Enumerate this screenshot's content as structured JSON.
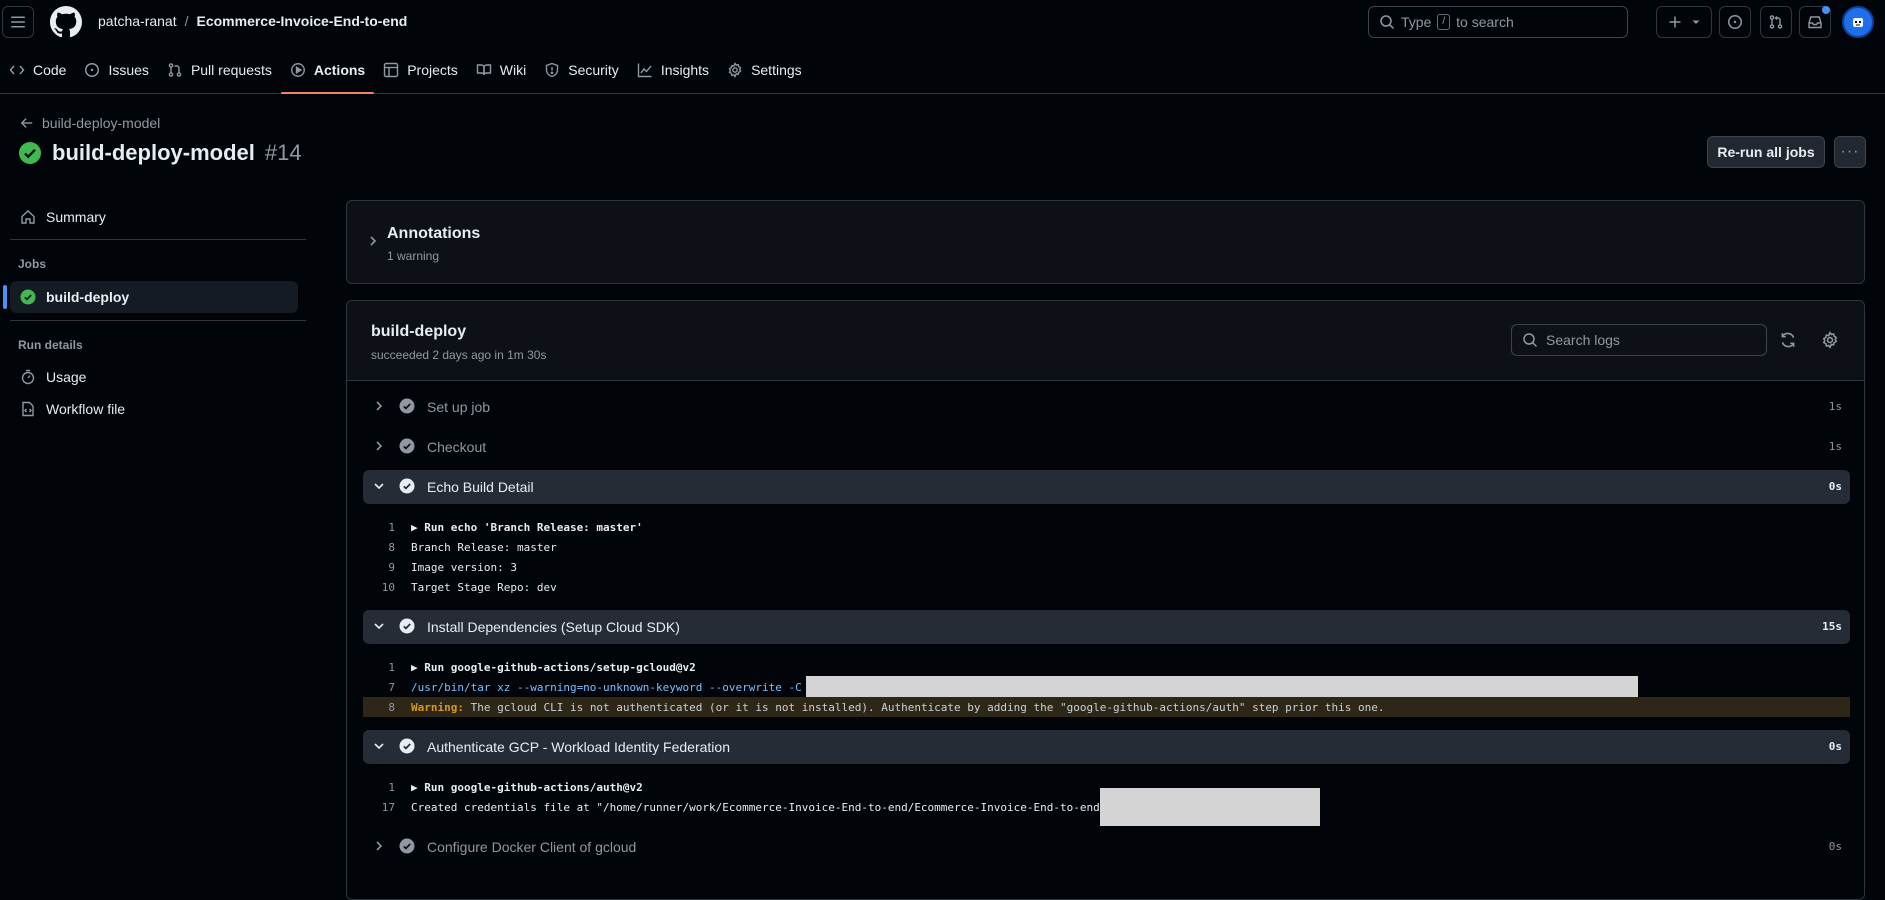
{
  "header": {
    "owner": "patcha-ranat",
    "separator": "/",
    "repo": "Ecommerce-Invoice-End-to-end",
    "search": {
      "pre": "Type",
      "key": "/",
      "post": "to search"
    }
  },
  "nav": {
    "tabs": [
      {
        "label": "Code",
        "icon": "code-icon"
      },
      {
        "label": "Issues",
        "icon": "issue-icon"
      },
      {
        "label": "Pull requests",
        "icon": "pull-request-icon"
      },
      {
        "label": "Actions",
        "icon": "play-icon",
        "active": true
      },
      {
        "label": "Projects",
        "icon": "table-icon"
      },
      {
        "label": "Wiki",
        "icon": "book-icon"
      },
      {
        "label": "Security",
        "icon": "shield-icon"
      },
      {
        "label": "Insights",
        "icon": "graph-icon"
      },
      {
        "label": "Settings",
        "icon": "gear-icon"
      }
    ]
  },
  "run": {
    "back_label": "build-deploy-model",
    "title": "build-deploy-model",
    "number": "#14",
    "rerun_label": "Re-run all jobs",
    "more_label": "···"
  },
  "sidebar": {
    "summary": "Summary",
    "jobs_heading": "Jobs",
    "job": "build-deploy",
    "run_details_heading": "Run details",
    "usage": "Usage",
    "workflow_file": "Workflow file"
  },
  "annotations": {
    "title": "Annotations",
    "subtitle": "1 warning"
  },
  "job": {
    "title": "build-deploy",
    "subtitle": "succeeded 2 days ago in 1m 30s",
    "search_placeholder": "Search logs"
  },
  "steps": [
    {
      "name": "Set up job",
      "time": "1s"
    },
    {
      "name": "Checkout",
      "time": "1s"
    },
    {
      "name": "Echo Build Detail",
      "time": "0s"
    },
    {
      "name": "Install Dependencies (Setup Cloud SDK)",
      "time": "15s"
    },
    {
      "name": "Authenticate GCP - Workload Identity Federation",
      "time": "0s"
    },
    {
      "name": "Configure Docker Client of gcloud",
      "time": "0s"
    }
  ],
  "logs": {
    "echo": [
      {
        "n": "1",
        "text": "▶ Run echo 'Branch Release: master'"
      },
      {
        "n": "8",
        "text": "Branch Release: master"
      },
      {
        "n": "9",
        "text": "Image version: 3"
      },
      {
        "n": "10",
        "text": "Target Stage Repo: dev"
      }
    ],
    "install": [
      {
        "n": "1",
        "text": "▶ Run google-github-actions/setup-gcloud@v2"
      },
      {
        "n": "7",
        "text": "/usr/bin/tar xz --warning=no-unknown-keyword --overwrite -C"
      },
      {
        "n": "8",
        "label": "Warning:",
        "text": " The gcloud CLI is not authenticated (or it is not installed). Authenticate by adding the \"google-github-actions/auth\" step prior this one."
      }
    ],
    "auth": [
      {
        "n": "1",
        "text": "▶ Run google-github-actions/auth@v2"
      },
      {
        "n": "17",
        "text": "Created credentials file at \"/home/runner/work/Ecommerce-Invoice-End-to-end/Ecommerce-Invoice-End-to-end"
      }
    ]
  }
}
